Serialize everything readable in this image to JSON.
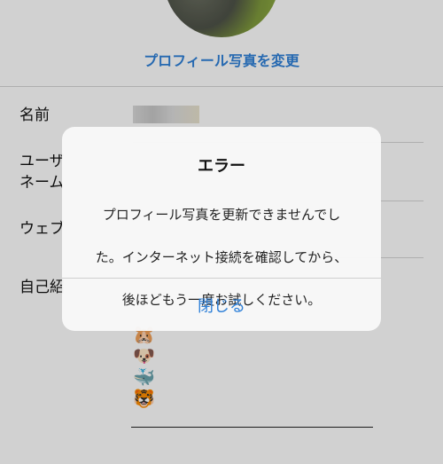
{
  "profile": {
    "change_photo_label": "プロフィール写真を変更",
    "rows": [
      {
        "label": "名前"
      },
      {
        "label": "ユーザーネーム",
        "label_line1": "ユーザ",
        "label_line2": "ネーム"
      },
      {
        "label": "ウェブ",
        "label_visible": "ウェブ"
      },
      {
        "label": "自己紹介",
        "label_visible": "自己紹"
      }
    ],
    "bio_emojis": [
      "🐹",
      "🐶",
      "🐳",
      "🐯"
    ]
  },
  "alert": {
    "title": "エラー",
    "message": "プロフィール写真を更新できませんでした。インターネット接続を確認してから、後ほどもう一度お試しください。",
    "message_lines": [
      "プロフィール写真を更新できませんでし",
      "た。インターネット接続を確認してから、",
      "後ほどもう一度お試しください。"
    ],
    "button_label": "閉じる"
  },
  "colors": {
    "link_blue": "#2f80d8"
  }
}
